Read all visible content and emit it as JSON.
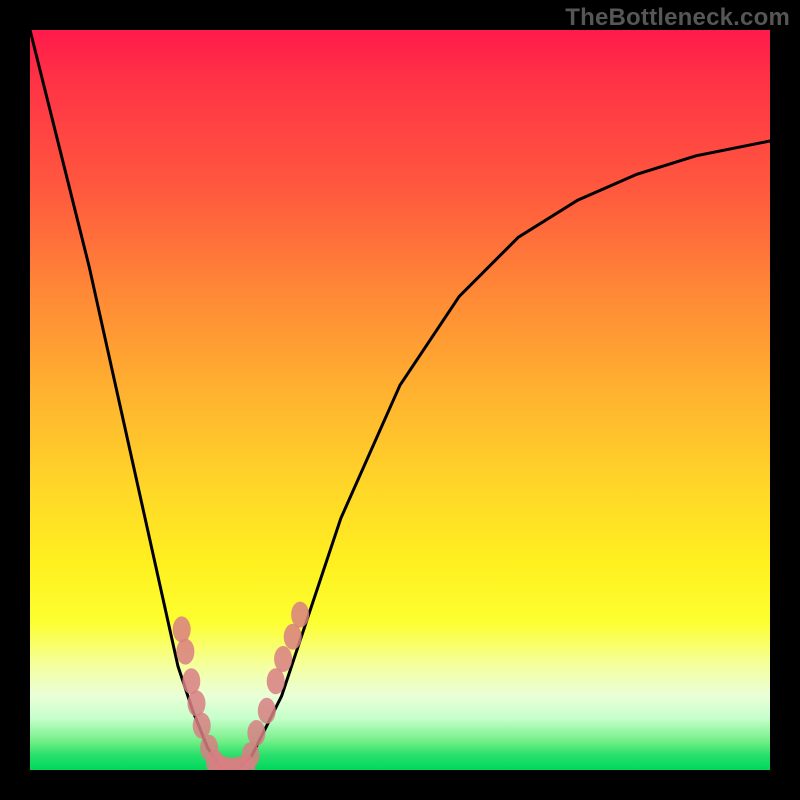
{
  "watermark": "TheBottleneck.com",
  "chart_data": {
    "type": "line",
    "title": "",
    "xlabel": "",
    "ylabel": "",
    "x_range": [
      0,
      1
    ],
    "y_range": [
      0,
      100
    ],
    "series": [
      {
        "name": "bottleneck-curve",
        "x": [
          0.0,
          0.04,
          0.08,
          0.12,
          0.16,
          0.2,
          0.22,
          0.24,
          0.26,
          0.28,
          0.3,
          0.34,
          0.38,
          0.42,
          0.5,
          0.58,
          0.66,
          0.74,
          0.82,
          0.9,
          1.0
        ],
        "y": [
          100,
          84,
          68,
          50,
          32,
          14,
          8,
          3,
          0,
          0,
          2,
          10,
          22,
          34,
          52,
          64,
          72,
          77,
          80.5,
          83,
          85
        ]
      }
    ],
    "markers_left": {
      "name": "left-cluster",
      "x": [
        0.205,
        0.21,
        0.218,
        0.225,
        0.232,
        0.242,
        0.25
      ],
      "y": [
        19,
        16,
        12,
        9,
        6,
        3,
        1
      ]
    },
    "markers_right": {
      "name": "right-cluster",
      "x": [
        0.298,
        0.306,
        0.32,
        0.332,
        0.342,
        0.355,
        0.365
      ],
      "y": [
        2,
        5,
        8,
        12,
        15,
        18,
        21
      ]
    },
    "markers_bottom": {
      "name": "bottom-cluster",
      "x": [
        0.255,
        0.262,
        0.272,
        0.282,
        0.292
      ],
      "y": [
        0.3,
        0.1,
        0.0,
        0.1,
        0.4
      ]
    },
    "gradient_stops": [
      {
        "pos": 0,
        "color": "#ff1a4a"
      },
      {
        "pos": 50,
        "color": "#ffb52f"
      },
      {
        "pos": 80,
        "color": "#fdff30"
      },
      {
        "pos": 100,
        "color": "#00d85e"
      }
    ],
    "plot_geometry": {
      "inner_left": 30,
      "inner_top": 30,
      "inner_w": 740,
      "inner_h": 740
    }
  }
}
